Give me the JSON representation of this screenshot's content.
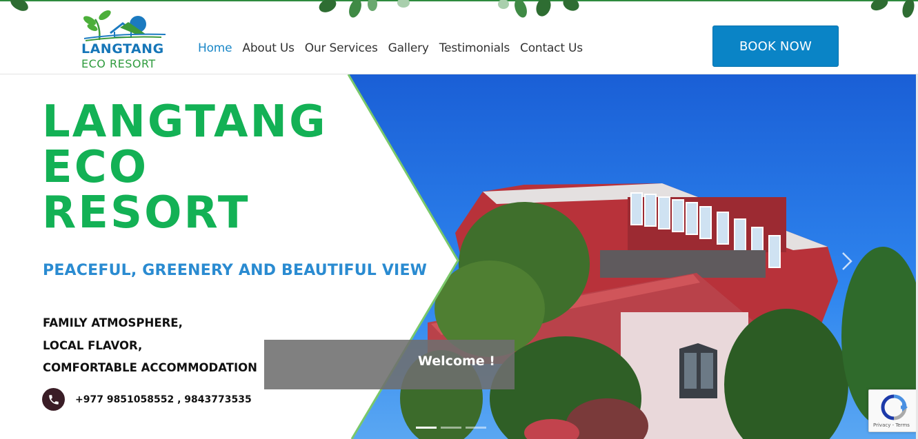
{
  "header": {
    "logo": {
      "line1": "LANGTANG",
      "line2": "ECO RESORT"
    },
    "nav": [
      {
        "label": "Home",
        "active": true
      },
      {
        "label": "About Us",
        "active": false
      },
      {
        "label": "Our Services",
        "active": false
      },
      {
        "label": "Gallery",
        "active": false
      },
      {
        "label": "Testimonials",
        "active": false
      },
      {
        "label": "Contact Us",
        "active": false
      }
    ],
    "book_button": "BOOK NOW"
  },
  "hero": {
    "title_lines": [
      "LANGTANG",
      "ECO",
      "RESORT"
    ],
    "subtitle": "PEACEFUL, GREENERY AND BEAUTIFUL VIEW",
    "features": [
      "FAMILY ATMOSPHERE,",
      "LOCAL FLAVOR,",
      "COMFORTABLE ACCOMMODATION"
    ],
    "phone": "+977 9851058552 , 9843773535",
    "caption": "Welcome !",
    "slides_total": 3,
    "slide_active": 1
  },
  "recaptcha": {
    "links": "Privacy - Terms"
  },
  "colors": {
    "brand_green": "#13b155",
    "brand_blue": "#0a84c6",
    "subtitle_blue": "#2a8bd1",
    "nav_active": "#1a87c7",
    "phone_icon_bg": "#3a1d26"
  },
  "icons": {
    "phone": "phone-icon",
    "next": "chevron-right-icon",
    "recaptcha": "recaptcha-icon"
  }
}
